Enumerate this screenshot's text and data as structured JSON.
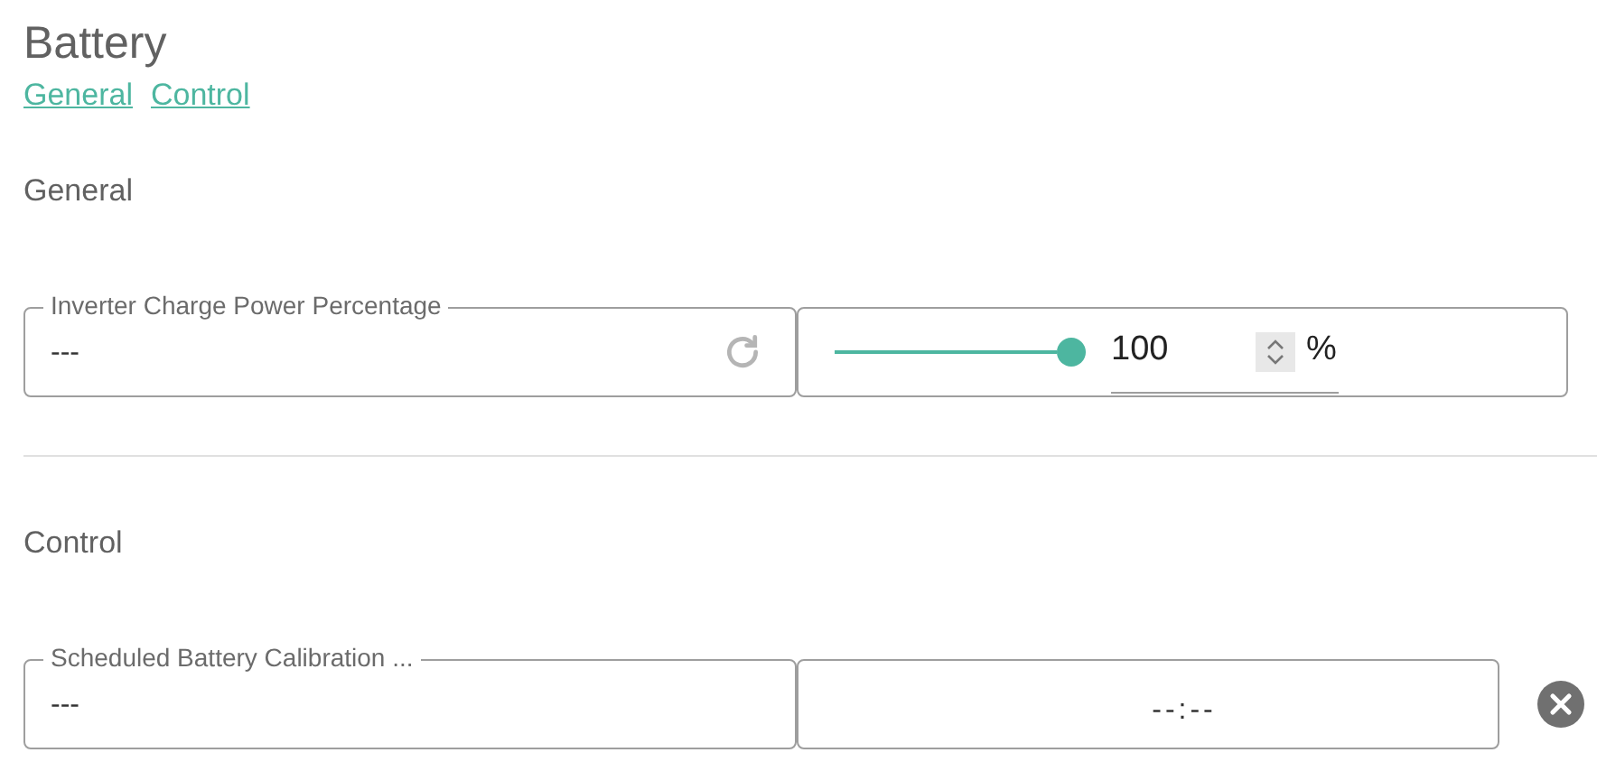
{
  "title": "Battery",
  "links": [
    "General",
    "Control"
  ],
  "sections": [
    {
      "heading": "General",
      "field": {
        "label": "Inverter Charge Power Percentage",
        "value": "---"
      },
      "control": {
        "kind": "slider",
        "level": 1.0,
        "value": "100",
        "unit": "%"
      }
    },
    {
      "heading": "Control",
      "field": {
        "label": "Scheduled Battery Calibration ...",
        "value": "---"
      },
      "control": {
        "kind": "time",
        "value": "--:--"
      }
    }
  ]
}
